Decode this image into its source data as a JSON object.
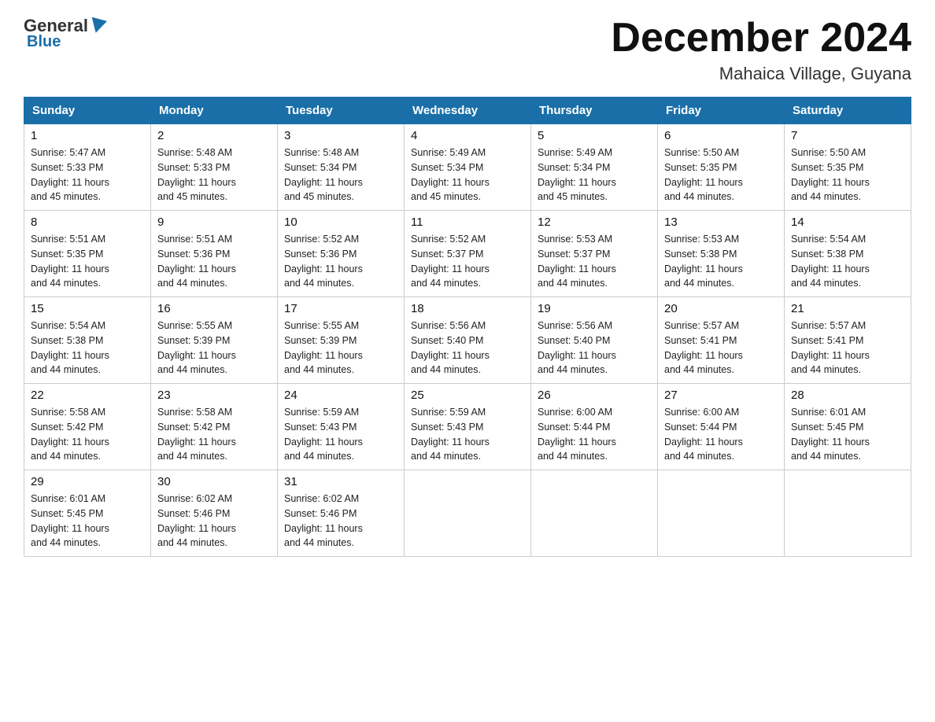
{
  "header": {
    "logo_general": "General",
    "logo_blue": "Blue",
    "month_title": "December 2024",
    "location": "Mahaica Village, Guyana"
  },
  "weekdays": [
    "Sunday",
    "Monday",
    "Tuesday",
    "Wednesday",
    "Thursday",
    "Friday",
    "Saturday"
  ],
  "weeks": [
    [
      {
        "day": "1",
        "sunrise": "5:47 AM",
        "sunset": "5:33 PM",
        "daylight": "11 hours and 45 minutes."
      },
      {
        "day": "2",
        "sunrise": "5:48 AM",
        "sunset": "5:33 PM",
        "daylight": "11 hours and 45 minutes."
      },
      {
        "day": "3",
        "sunrise": "5:48 AM",
        "sunset": "5:34 PM",
        "daylight": "11 hours and 45 minutes."
      },
      {
        "day": "4",
        "sunrise": "5:49 AM",
        "sunset": "5:34 PM",
        "daylight": "11 hours and 45 minutes."
      },
      {
        "day": "5",
        "sunrise": "5:49 AM",
        "sunset": "5:34 PM",
        "daylight": "11 hours and 45 minutes."
      },
      {
        "day": "6",
        "sunrise": "5:50 AM",
        "sunset": "5:35 PM",
        "daylight": "11 hours and 44 minutes."
      },
      {
        "day": "7",
        "sunrise": "5:50 AM",
        "sunset": "5:35 PM",
        "daylight": "11 hours and 44 minutes."
      }
    ],
    [
      {
        "day": "8",
        "sunrise": "5:51 AM",
        "sunset": "5:35 PM",
        "daylight": "11 hours and 44 minutes."
      },
      {
        "day": "9",
        "sunrise": "5:51 AM",
        "sunset": "5:36 PM",
        "daylight": "11 hours and 44 minutes."
      },
      {
        "day": "10",
        "sunrise": "5:52 AM",
        "sunset": "5:36 PM",
        "daylight": "11 hours and 44 minutes."
      },
      {
        "day": "11",
        "sunrise": "5:52 AM",
        "sunset": "5:37 PM",
        "daylight": "11 hours and 44 minutes."
      },
      {
        "day": "12",
        "sunrise": "5:53 AM",
        "sunset": "5:37 PM",
        "daylight": "11 hours and 44 minutes."
      },
      {
        "day": "13",
        "sunrise": "5:53 AM",
        "sunset": "5:38 PM",
        "daylight": "11 hours and 44 minutes."
      },
      {
        "day": "14",
        "sunrise": "5:54 AM",
        "sunset": "5:38 PM",
        "daylight": "11 hours and 44 minutes."
      }
    ],
    [
      {
        "day": "15",
        "sunrise": "5:54 AM",
        "sunset": "5:38 PM",
        "daylight": "11 hours and 44 minutes."
      },
      {
        "day": "16",
        "sunrise": "5:55 AM",
        "sunset": "5:39 PM",
        "daylight": "11 hours and 44 minutes."
      },
      {
        "day": "17",
        "sunrise": "5:55 AM",
        "sunset": "5:39 PM",
        "daylight": "11 hours and 44 minutes."
      },
      {
        "day": "18",
        "sunrise": "5:56 AM",
        "sunset": "5:40 PM",
        "daylight": "11 hours and 44 minutes."
      },
      {
        "day": "19",
        "sunrise": "5:56 AM",
        "sunset": "5:40 PM",
        "daylight": "11 hours and 44 minutes."
      },
      {
        "day": "20",
        "sunrise": "5:57 AM",
        "sunset": "5:41 PM",
        "daylight": "11 hours and 44 minutes."
      },
      {
        "day": "21",
        "sunrise": "5:57 AM",
        "sunset": "5:41 PM",
        "daylight": "11 hours and 44 minutes."
      }
    ],
    [
      {
        "day": "22",
        "sunrise": "5:58 AM",
        "sunset": "5:42 PM",
        "daylight": "11 hours and 44 minutes."
      },
      {
        "day": "23",
        "sunrise": "5:58 AM",
        "sunset": "5:42 PM",
        "daylight": "11 hours and 44 minutes."
      },
      {
        "day": "24",
        "sunrise": "5:59 AM",
        "sunset": "5:43 PM",
        "daylight": "11 hours and 44 minutes."
      },
      {
        "day": "25",
        "sunrise": "5:59 AM",
        "sunset": "5:43 PM",
        "daylight": "11 hours and 44 minutes."
      },
      {
        "day": "26",
        "sunrise": "6:00 AM",
        "sunset": "5:44 PM",
        "daylight": "11 hours and 44 minutes."
      },
      {
        "day": "27",
        "sunrise": "6:00 AM",
        "sunset": "5:44 PM",
        "daylight": "11 hours and 44 minutes."
      },
      {
        "day": "28",
        "sunrise": "6:01 AM",
        "sunset": "5:45 PM",
        "daylight": "11 hours and 44 minutes."
      }
    ],
    [
      {
        "day": "29",
        "sunrise": "6:01 AM",
        "sunset": "5:45 PM",
        "daylight": "11 hours and 44 minutes."
      },
      {
        "day": "30",
        "sunrise": "6:02 AM",
        "sunset": "5:46 PM",
        "daylight": "11 hours and 44 minutes."
      },
      {
        "day": "31",
        "sunrise": "6:02 AM",
        "sunset": "5:46 PM",
        "daylight": "11 hours and 44 minutes."
      },
      null,
      null,
      null,
      null
    ]
  ],
  "labels": {
    "sunrise": "Sunrise:",
    "sunset": "Sunset:",
    "daylight": "Daylight:"
  }
}
